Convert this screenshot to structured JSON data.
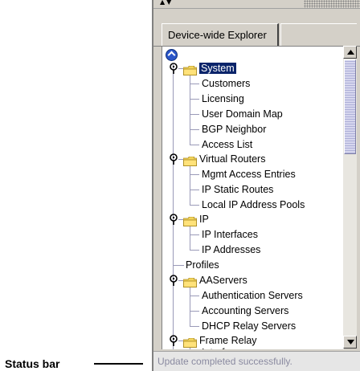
{
  "callout": {
    "label": "Status bar"
  },
  "tab": {
    "label": "Device-wide Explorer"
  },
  "tree": {
    "system": "System",
    "system_children": [
      "Customers",
      "Licensing",
      "User Domain Map",
      "BGP Neighbor",
      "Access List"
    ],
    "virtual_routers": "Virtual Routers",
    "vr_children": [
      "Mgmt Access Entries",
      "IP Static Routes",
      "Local IP Address Pools"
    ],
    "ip": "IP",
    "ip_children": [
      "IP Interfaces",
      "IP Addresses"
    ],
    "profiles": "Profiles",
    "aaservers": "AAServers",
    "aa_children": [
      "Authentication Servers",
      "Accounting Servers",
      "DHCP Relay Servers"
    ],
    "frame_relay": "Frame Relay",
    "fr_children": [
      "Interfaces"
    ]
  },
  "status": {
    "text": "Update completed successfully."
  },
  "colors": {
    "selection": "#0a246a",
    "folder": "#f2d45c",
    "panel": "#d4d0c8"
  }
}
